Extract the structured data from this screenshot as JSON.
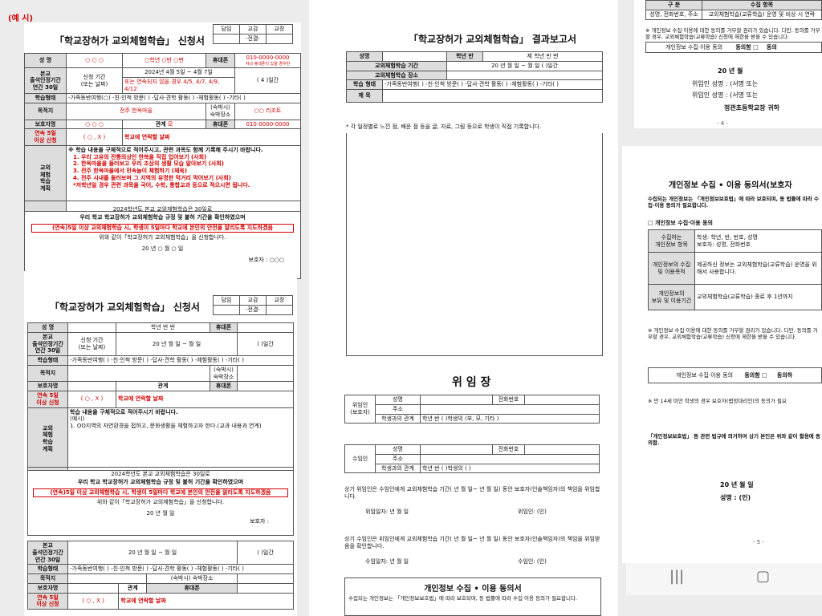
{
  "example_label": "(예 시)",
  "formA": {
    "title": "「학교장허가 교외체험학습」 신청서",
    "approval": [
      "담임",
      "교감",
      "교장"
    ],
    "approval_value": "-전결-",
    "name_label": "성 명",
    "name_value": "○ ○ ○",
    "class_value": "○학년 ○반 ○번",
    "phone_label": "휴대폰",
    "phone_value": "010-0000-0000",
    "phone_note": "자녀 휴대폰이 있을 경우만",
    "period_label1": "본교\n출석인정기간\n연간 30일",
    "period_label2": "신청 기간\n(또는 날짜)",
    "period_value": "2024년 4월 5일 ~ 4월 7일",
    "period_note": "또는 연속되지 않을 경우 4/5, 4/7, 4/9, 4/12",
    "days_value": "( 4 )일간",
    "type_label": "학습형태",
    "type_value": "-가족동반여행(○) -친·인척 방문( ) -답사·견학 활동( ) -체험활동( ) -기타( )",
    "dest_label": "목적지",
    "dest_value": "전주 한옥마을",
    "lodging_label": "(숙박시) 숙박장소",
    "lodging_value": "○○ 리조트",
    "guardian_label": "보호자명",
    "guardian_value": "○ ○ ○",
    "relation_label": "관계",
    "relation_value": "모",
    "gphone_value": "010-0000-0000",
    "consec_label": "연속 5일\n이상 신청",
    "consec_value": "( ○ , X )",
    "consec_note": "학교에 연락할 날짜",
    "plan_label": "교외\n체험\n학습\n계획",
    "plan_intro": "※ 학습 내용을 구체적으로 적어주시고, 관련 과목도 함께 기록해 주시기 바랍니다.",
    "plan_items": [
      "1. 우리 고유의 전통의상인 한복을 직접 입어보기 (사회)",
      "2. 한옥마을을 둘러보고 우리 조상의 생활 모습 알아보기 (사회)",
      "3. 전주 한옥마을에서 민속놀이 체험하기 (체육)",
      "4. 전주 시내를 둘러보며 그 지역의 유명한 먹거리 먹어보기 (사회)",
      "*저학년일 경우 관련 과목을 국어, 수학, 통합교과 등으로 적으시면 됩니다."
    ],
    "rule1": "2024학년도 본교 교외체험학습은 30일로",
    "rule2": "우리 학교 학교장허가 교외체험학습 규정 및 붙허 기간을 확인하였으며",
    "rule3": "(연속)5일 이상 교외체험학습 시, 학생이 5일마다 학교에 본인의 안전을 알리도록 지도하겠음",
    "rule4": "위와 같이「학교장허가 교외체험학습」을 신청합니다.",
    "date_line": "20 년 ○ 월 ○ 일",
    "signer": "보호자 : ○○○"
  },
  "formB": {
    "title": "「학교장허가 교외체험학습」 신청서",
    "class_value": "학년 반 번",
    "period_value": "20 년 월 일 ~ 월 일",
    "days_value": "( )일간",
    "type_value": "-가족동반여행( ) -친·인척 방문( ) -답사·견학 활동( ) -체험활동( ) -기타( )",
    "lodging_label": "(숙박시) 숙박장소",
    "plan_intro": "학습 내용을 구체적으로 적어주시기 바랍니다.",
    "plan_example": "(예시)",
    "plan_example_text": "1. OO지역의 자연환경을 접하고, 문화생활을 체험하고자 한다.(교과 내용과 연계)",
    "date_line": "20 년 월 일",
    "signer": "보호자 :",
    "consec_label": "연속 5일\n이상 신청",
    "consec_value": "( ○ , X )",
    "consec_note": "학교에 연락할 날짜"
  },
  "report": {
    "title": "「학교장허가 교외체험학습」 결과보고서",
    "name_label": "성명",
    "class_label": "학년 반",
    "class_value": "제 학년 반 번",
    "period_label": "교외체험학습 기간",
    "period_value": "20 년 월 일 ~ 월 일 ( )일간",
    "place_label": "교외체험학습 장소",
    "type_label": "학습 형태",
    "type_value": "-가족동반여행( ) -친·인척 방문( ) -답사·견학 활동( ) -체험활동( ) -기타( )",
    "subject_label": "제 목",
    "note": "* 각 일정별로 느낀 점, 배운 점 등을 글, 자료, 그림 등으로 학생이 직접 기록합니다."
  },
  "proxy": {
    "title": "위 임 장",
    "delegator_label": "위임인\n(보호자)",
    "delegatee_label": "수임인",
    "name_label": "성명",
    "phone_label": "전화번호",
    "addr_label": "주소",
    "rel_label": "학생과의 관계",
    "rel_value1": "학년 반 ( )학생의 (부, 모, 기타 )",
    "rel_value2": "학년 반 ( )학생의 ( )",
    "text1": "상기 위임인은 수임인에게 교외체험학습 기간( 년 월 일~ 년 월 일) 동안 보호자(인솔책임자)의 책임을 위임합니다.",
    "sig1": "위임일자: 년 월 일",
    "sig1b": "위임인: (인)",
    "text2": "상기 수임인은 위임인에게 교외체험학습 기간( 년 월 일~ 년 월 일) 동안 보호자(인솔책임자)의 책임을 위임받음을 확인합니다.",
    "sig2": "수임일자: 년 월 일",
    "sig2b": "수임인: (인)",
    "consent_title": "개인정보 수집 • 이용 동의서",
    "consent_text": "수집되는 개인정보는 「개인정보보호법」에 따라 보호되며, 동 법률에 따라 수집·이용 동의가 필요합니다."
  },
  "page4": {
    "row_header": [
      "구 분",
      "수집 항목"
    ],
    "row1": [
      "성명, 전화번호, 주소",
      "교외체험학습(교류학습) 운영 및 비상 시 연락"
    ],
    "note": "※ 개인정보 수집·이용에 대한 동의를 거부할 권리가 있습니다. 다만, 동의를 거부할 경우, 교외체험학습(교류학습) 신청에 제한을 받을 수 있습니다.",
    "agree_label": "개인정보 수집·이용 동의",
    "agree": "동의함 □",
    "disagree": "동의",
    "date_line": "20 년 월",
    "sig1": "위임인 성명 : (서명 또는",
    "sig2": "위임인 성명 : (서명 또는",
    "to": "정관초등학교장 귀하",
    "page": "- 4 -"
  },
  "page5": {
    "title": "개인정보 수집 • 이용 동의서(보호자",
    "intro": "수집되는 개인정보는 「개인정보보호법」에 따라 보호되며, 동 법률에 따라 수집·이용 동의가 필요합니다.",
    "section": "□ 개인정보 수집·이용 동의",
    "rows": [
      [
        "수집하는\n개인정보 항목",
        "학생: 학년, 반, 번호, 성명\n보호자: 성명, 전화번호"
      ],
      [
        "개인정보의 수집\n및 이용목적",
        "제공하신 정보는 교외체험학습(교류학습) 운영을 위해서 사용합니다."
      ],
      [
        "개인정보의\n보유 및 이용기간",
        "교외체험학습(교류학습) 종료 후 1년까지"
      ]
    ],
    "note": "※ 개인정보 수집·이용에 대한 동의를 거부할 권리가 있습니다. 다만, 동의를 거부할 경우, 교외체험학습(교류학습) 신청에 제한을 받을 수 있습니다.",
    "agree_label": "개인정보 수집·이용 동의",
    "agree": "동의함 □",
    "disagree": "동의하",
    "minor": "※ 만 14세 미만 학생의 경우 보호자(법정대리인)의 동의가 필요",
    "law": "「개인정보보호법」 등 관련 법규에 의거하여 상기 본인은 위와 같이 활용에 동의함.",
    "date_line": "20 년 월 일",
    "signer": "성명 : (인)",
    "page": "- 5 -"
  },
  "nav": {
    "recent": "|||",
    "home": "▢"
  }
}
